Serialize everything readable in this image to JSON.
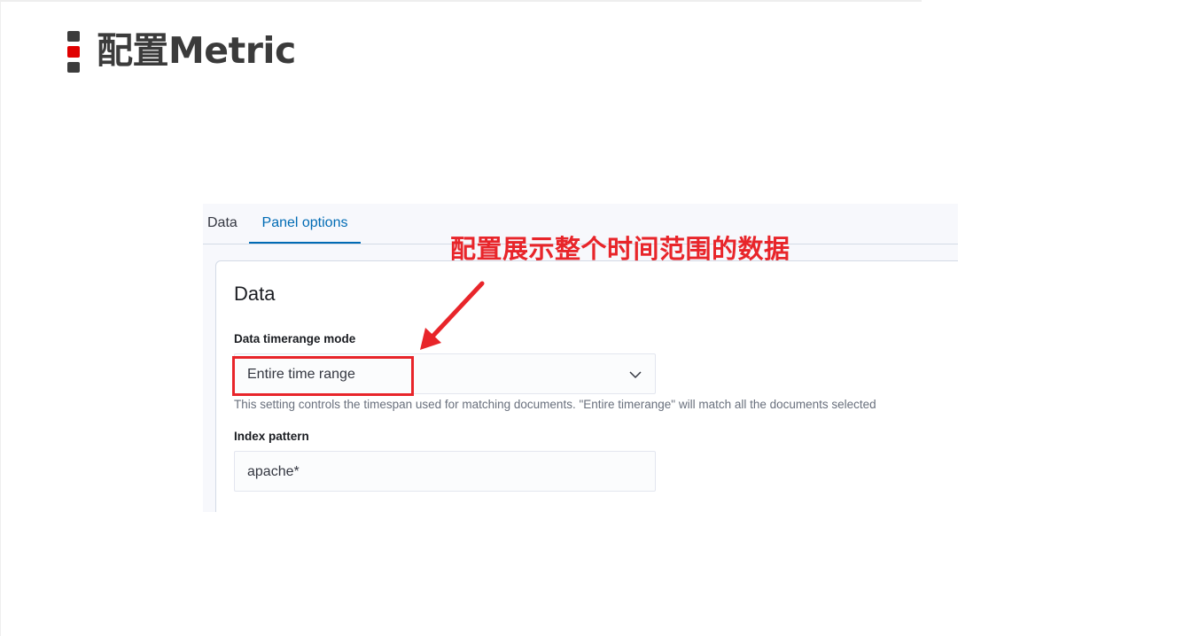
{
  "slide": {
    "title": "配置Metric"
  },
  "tabs": [
    {
      "label": "Data",
      "active": false
    },
    {
      "label": "Panel options",
      "active": true
    }
  ],
  "panel": {
    "heading": "Data",
    "timerange_mode": {
      "label": "Data timerange mode",
      "value": "Entire time range",
      "icon": "chevron-down-icon",
      "help": "This setting controls the timespan used for matching documents. \"Entire timerange\" will match all the documents selected"
    },
    "index_pattern": {
      "label": "Index pattern",
      "value": "apache*"
    }
  },
  "annotation": {
    "text": "配置展示整个时间范围的数据",
    "color": "#e8252a"
  },
  "colors": {
    "accent": "#006bb4",
    "annotation": "#e8252a",
    "bullet_red": "#e00000",
    "bullet_dark": "#3c3c3c"
  }
}
